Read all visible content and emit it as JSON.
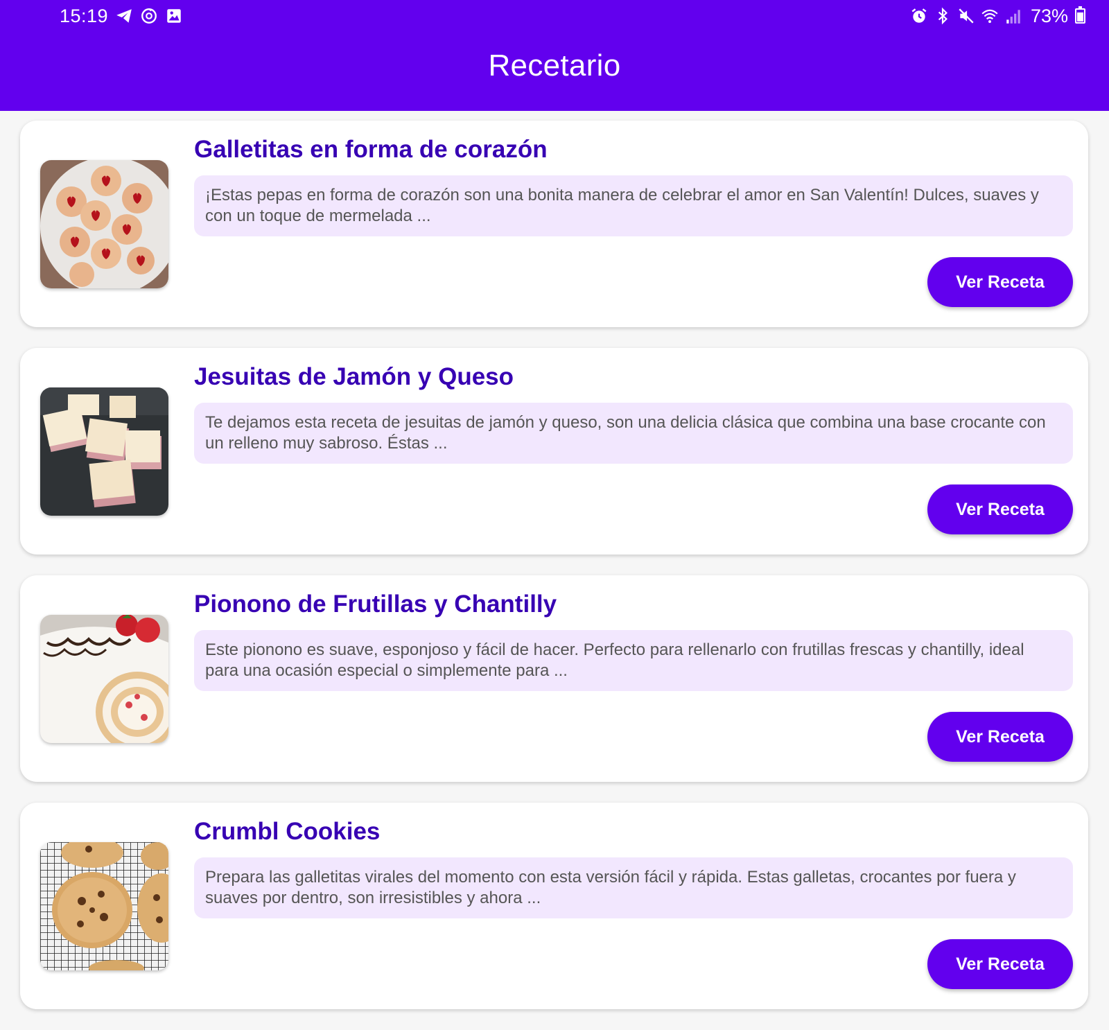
{
  "status_bar": {
    "time": "15:19",
    "battery": "73%",
    "battery_level": 0.73,
    "left_icons": [
      "telegram-icon",
      "sync-icon",
      "gallery-icon"
    ],
    "right_icons": [
      "alarm-icon",
      "bluetooth-icon",
      "mute-icon",
      "wifi-icon",
      "signal-icon"
    ]
  },
  "header": {
    "title": "Recetario"
  },
  "colors": {
    "primary": "#6200ee",
    "title_text": "#3700b3",
    "description_bg": "#f2e7fe"
  },
  "recipes": [
    {
      "title": "Galletitas en forma de corazón",
      "description": "¡Estas pepas en forma de corazón son una bonita manera de celebrar el amor en San Valentín! Dulces, suaves y con un toque de mermelada ...",
      "button_label": "Ver Receta"
    },
    {
      "title": "Jesuitas de Jamón y Queso",
      "description": "Te dejamos esta receta de jesuitas de jamón y queso, son una delicia clásica que combina una base crocante con un relleno muy sabroso. Éstas ...",
      "button_label": "Ver Receta"
    },
    {
      "title": "Pionono de Frutillas y Chantilly",
      "description": "Este pionono es suave, esponjoso y fácil de hacer. Perfecto para rellenarlo con frutillas frescas y chantilly, ideal para una ocasión especial o simplemente para ...",
      "button_label": "Ver Receta"
    },
    {
      "title": "Crumbl Cookies",
      "description": "Prepara las galletitas virales del momento con esta versión fácil y rápida. Estas galletas, crocantes por fuera y suaves por dentro, son irresistibles y ahora ...",
      "button_label": "Ver Receta"
    }
  ]
}
